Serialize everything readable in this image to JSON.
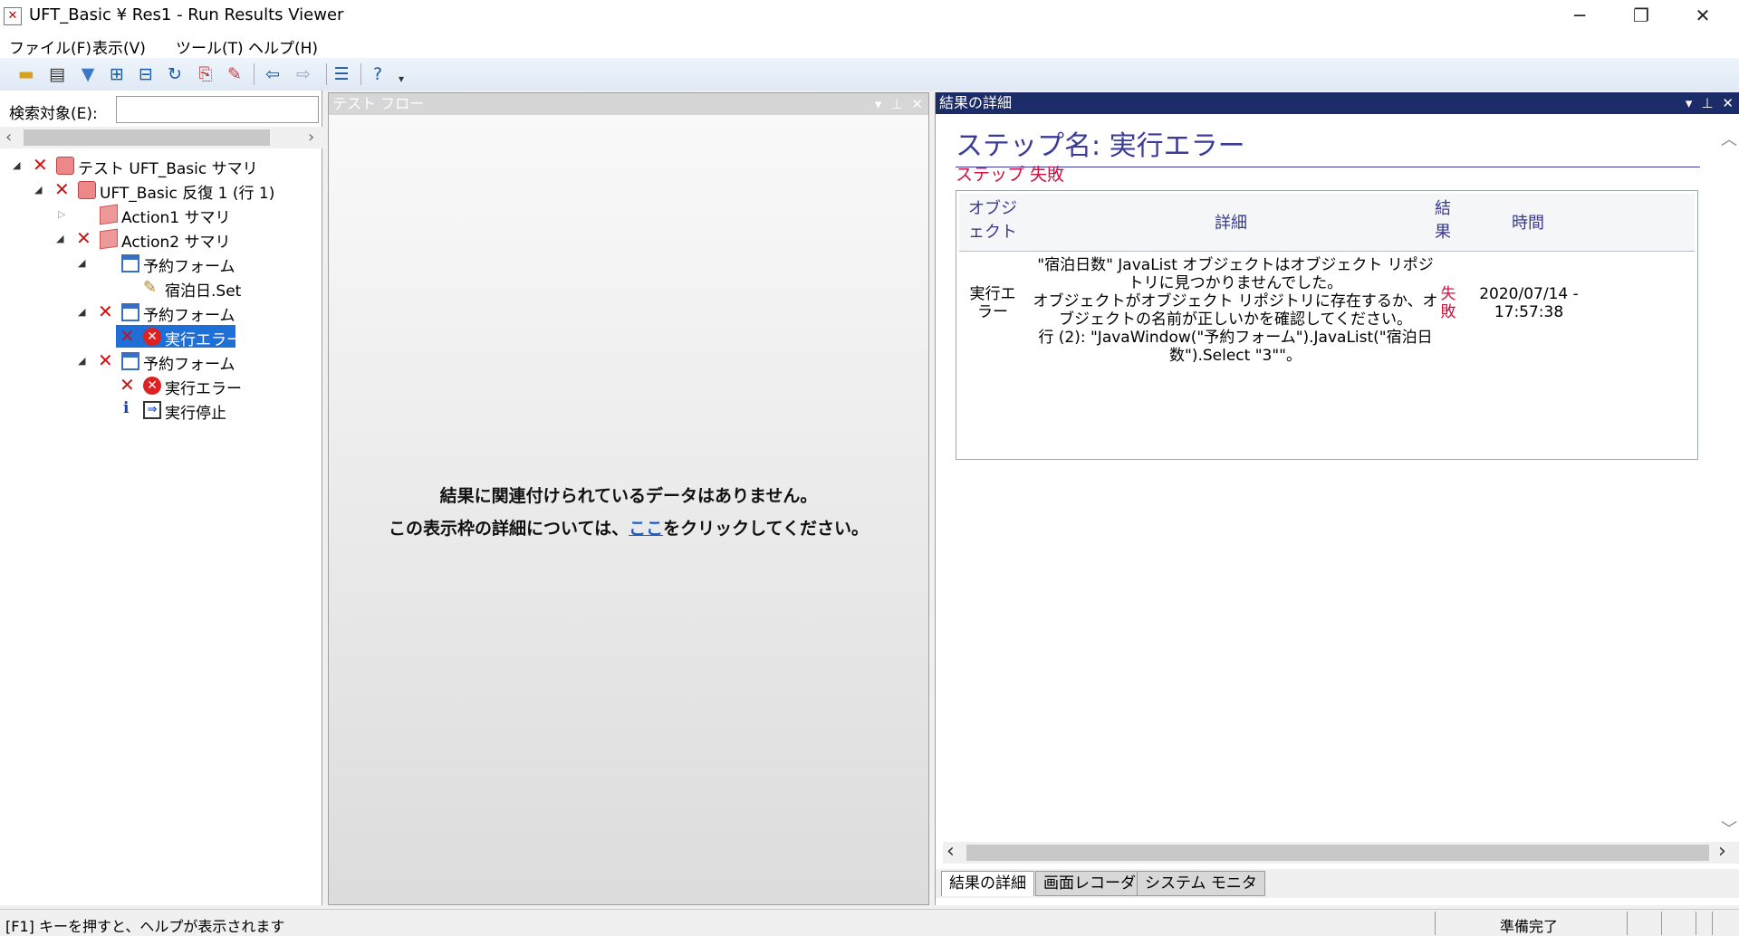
{
  "window": {
    "title": "UFT_Basic ¥ Res1 - Run Results Viewer",
    "app_icon": "results-viewer-icon"
  },
  "window_controls": {
    "minimize": "─",
    "restore": "❐",
    "close": "✕"
  },
  "menu": [
    "ファイル(F)",
    "表示(V)",
    "ツール(T)",
    "ヘルプ(H)"
  ],
  "toolbar": {
    "icons": [
      "open-folder-icon",
      "print-icon",
      "filter-icon",
      "expand-all-icon",
      "collapse-all-icon",
      "refresh-icon",
      "export-icon",
      "edit-icon",
      "back-arrow-icon",
      "forward-arrow-icon",
      "list-icon",
      "help-icon"
    ]
  },
  "search": {
    "label": "検索対象(E):",
    "value": ""
  },
  "tree": [
    {
      "label": "テスト UFT_Basic サマリ",
      "status": "fail",
      "icon": "summary-icon",
      "expander": "expanded"
    },
    {
      "label": "UFT_Basic 反復 1 (行 1)",
      "status": "fail",
      "icon": "iteration-icon",
      "expander": "expanded"
    },
    {
      "label": "Action1 サマリ",
      "status": "none",
      "icon": "action-icon",
      "expander": "collapsed"
    },
    {
      "label": "Action2 サマリ",
      "status": "fail",
      "icon": "action-icon",
      "expander": "expanded"
    },
    {
      "label": "予約フォーム",
      "status": "none",
      "icon": "window-icon",
      "expander": "expanded"
    },
    {
      "label": "宿泊日.Set",
      "status": "none",
      "icon": "pencil-icon",
      "expander": "none"
    },
    {
      "label": "予約フォーム",
      "status": "fail",
      "icon": "window-icon",
      "expander": "expanded"
    },
    {
      "label": "実行エラー",
      "status": "fail",
      "icon": "error-icon",
      "expander": "none",
      "selected": true
    },
    {
      "label": "予約フォーム",
      "status": "fail",
      "icon": "window-icon",
      "expander": "expanded"
    },
    {
      "label": "実行エラー",
      "status": "fail",
      "icon": "error-icon",
      "expander": "none"
    },
    {
      "label": "実行停止",
      "status": "info",
      "icon": "stop-icon",
      "expander": "none"
    }
  ],
  "test_flow": {
    "title": "テスト フロー",
    "message_line1": "結果に関連付けられているデータはありません。",
    "message_line2_prefix": "この表示枠の詳細については、",
    "message_link": "ここ",
    "message_line2_suffix": "をクリックしてください。"
  },
  "details": {
    "pane_title": "結果の詳細",
    "step_title": "ステップ名: 実行エラー",
    "step_status": "ステップ 失敗",
    "columns": {
      "object": "オブジェクト",
      "detail": "詳細",
      "result": "結果",
      "time": "時間"
    },
    "row": {
      "object": "実行エラー",
      "detail_line1": "\"宿泊日数\" JavaList オブジェクトはオブジェクト リポジトリに見つかりませんでした。",
      "detail_line2": "オブジェクトがオブジェクト リポジトリに存在するか、オブジェクトの名前が正しいかを確認してください。",
      "detail_line3": "行 (2): \"JavaWindow(\"予約フォーム\").JavaList(\"宿泊日数\").Select \"3\"\"。",
      "result": "失敗",
      "time": "2020/07/14 - 17:57:38"
    },
    "tabs": [
      "結果の詳細",
      "画面レコーダ",
      "システム モニタ"
    ],
    "active_tab": "結果の詳細",
    "fail_color": "#d01040",
    "title_color": "#3a3a9a"
  },
  "statusbar": {
    "help_text": "[F1] キーを押すと、ヘルプが表示されます",
    "state": "準備完了"
  }
}
